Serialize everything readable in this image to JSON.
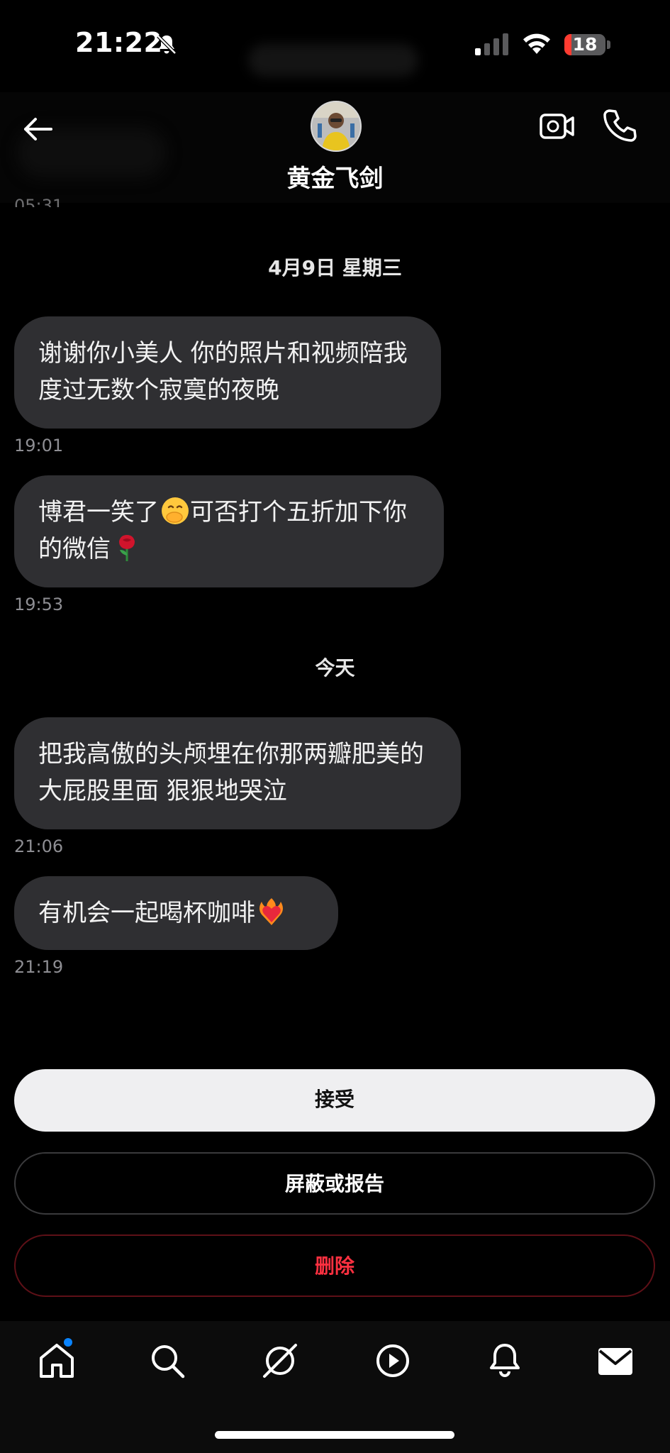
{
  "status_bar": {
    "time": "21:22",
    "battery": "18",
    "battery_level": 0.18,
    "icons": [
      "bell-muted-icon",
      "cellular-signal-icon",
      "wifi-icon",
      "battery-icon"
    ]
  },
  "header": {
    "contact_name": "黄金飞剑",
    "icons": [
      "back-arrow-icon",
      "video-call-icon",
      "phone-call-icon"
    ]
  },
  "conversation": {
    "clipped_time": "05:31",
    "date_separators": [
      "4月9日 星期三",
      "今天"
    ],
    "messages": [
      {
        "text": "谢谢你小美人 你的照片和视频陪我度过无数个寂寞的夜晚",
        "emoji": "",
        "time": "19:01"
      },
      {
        "text": "博君一笑了",
        "text_after_emoji": "可否打个五折加下你的微信",
        "emoji": "face-with-hand-over-mouth",
        "emoji_end": "rose",
        "time": "19:53"
      },
      {
        "text": "把我高傲的头颅埋在你那两瓣肥美的大屁股里面 狠狠地哭泣",
        "emoji": "",
        "time": "21:06"
      },
      {
        "text": "有机会一起喝杯咖啡",
        "emoji": "heart-on-fire",
        "time": "21:19"
      }
    ]
  },
  "actions": {
    "accept_label": "接受",
    "block_label": "屏蔽或报告",
    "delete_label": "删除"
  },
  "tab_bar": {
    "tabs": [
      "home-icon",
      "search-icon",
      "explore-compass-icon",
      "reels-play-icon",
      "notifications-bell-icon",
      "inbox-mail-icon"
    ],
    "home_has_badge": true
  },
  "colors": {
    "background": "#000000",
    "bubble": "#2f2f32",
    "accept_button": "#efeff1",
    "delete_text": "#ff3040",
    "badge": "#0a84ff"
  }
}
